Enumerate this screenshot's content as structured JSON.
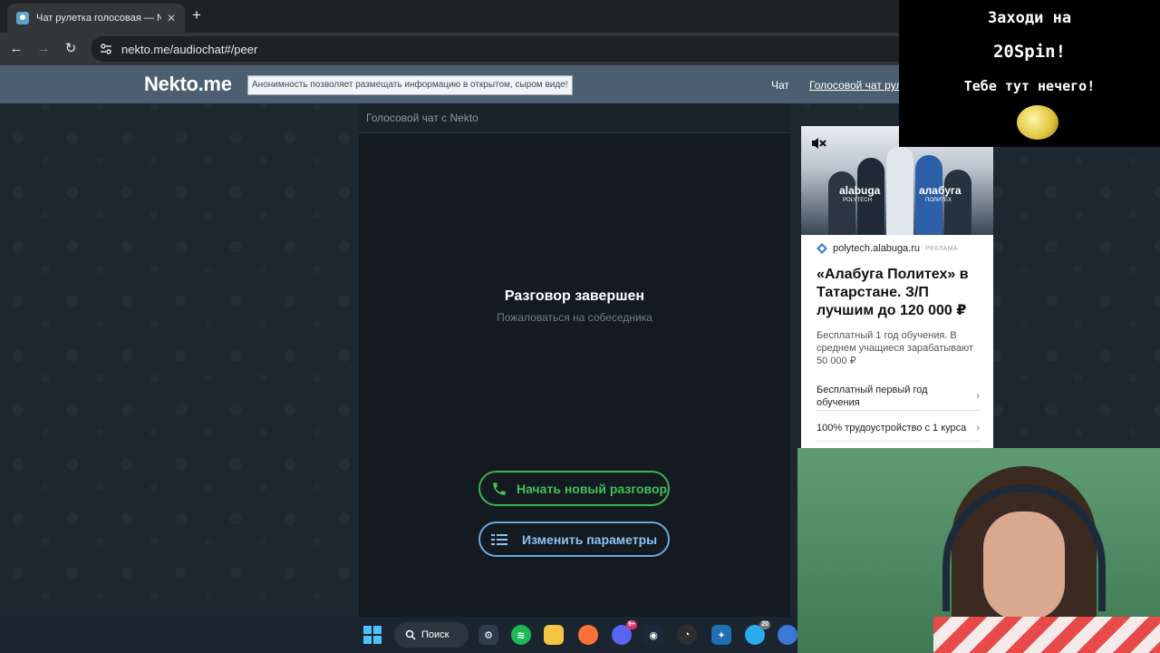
{
  "browser": {
    "tab_title": "Чат рулетка голосовая — Nekto",
    "new_tab_label": "+",
    "url": "nekto.me/audiochat#/peer"
  },
  "site": {
    "logo": "Nekto.me",
    "notice": "Анонимность позволяет размещать информацию в открытом, сыром виде!",
    "menu": {
      "chat": "Чат",
      "voice_chat": "Голосовой чат рулет"
    }
  },
  "chat": {
    "header": "Голосовой чат с Nekto",
    "ended_title": "Разговор завершен",
    "complain_link": "Пожаловаться на собеседника",
    "new_conversation_button": "Начать новый разговор",
    "change_params_button": "Изменить параметры",
    "colors": {
      "green": "#3fb14f",
      "blue": "#6fa8dc"
    }
  },
  "ad": {
    "brand_left": "alabuga",
    "brand_left_sub": "POLYTECH",
    "brand_right": "алабуга",
    "brand_right_sub": "ПОЛИТЕХ",
    "domain": "polytech.alabuga.ru",
    "tag": "РЕКЛАМА",
    "title": "«Алабуга Политех» в Татарстане. З/П лучшим до 120 000 ₽",
    "text": "Бесплатный 1 год обучения. В среднем учащиеся зарабатывают 50 000 ₽",
    "links": [
      "Бесплатный первый год обучения",
      "100% трудоустройство с 1 курса"
    ]
  },
  "overlay": {
    "line1": "Заходи на",
    "line2": "20Spin!",
    "line3": "Тебе тут нечего!"
  },
  "taskbar": {
    "search_label": "Поиск",
    "discord_badge": "9+",
    "telegram_badge": "20"
  }
}
